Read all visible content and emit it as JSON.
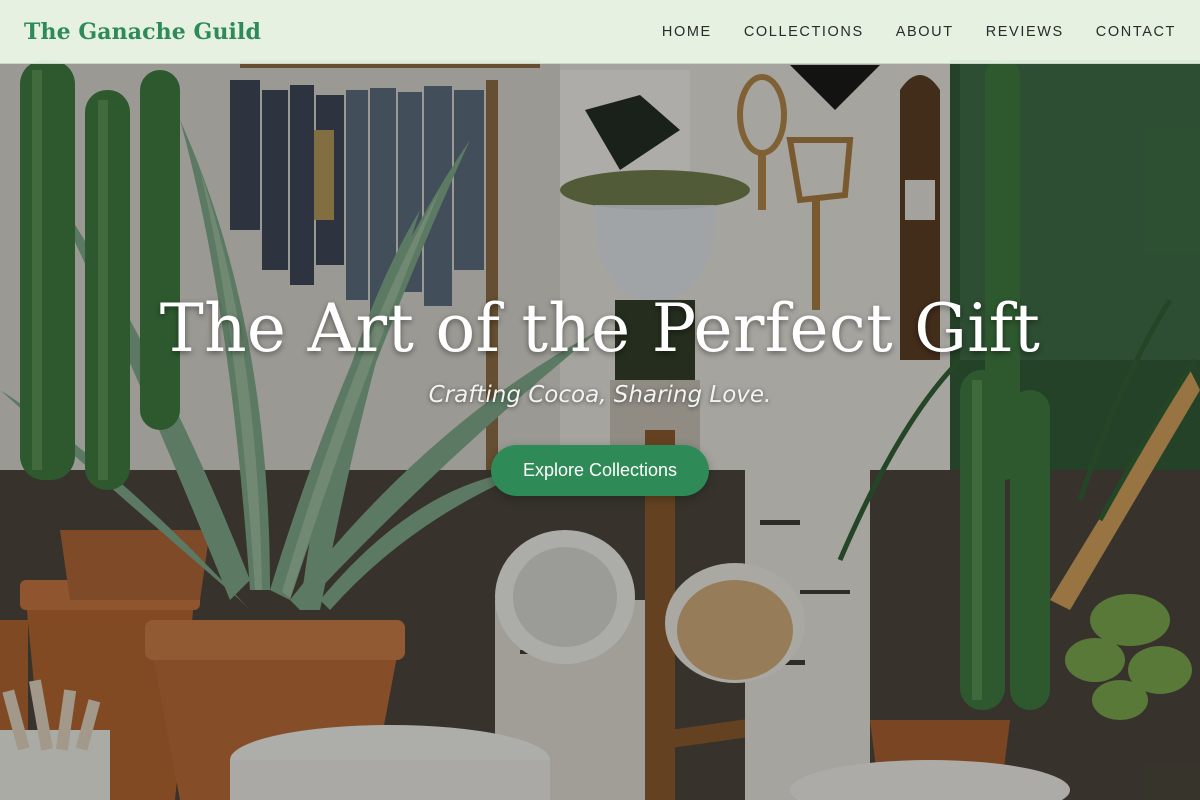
{
  "header": {
    "brand": "The Ganache Guild",
    "nav": [
      {
        "label": "HOME"
      },
      {
        "label": "COLLECTIONS"
      },
      {
        "label": "ABOUT"
      },
      {
        "label": "REVIEWS"
      },
      {
        "label": "CONTACT"
      }
    ]
  },
  "hero": {
    "title": "The Art of the Perfect Gift",
    "subtitle": "Crafting Cocoa, Sharing Love.",
    "cta_label": "Explore Collections"
  },
  "colors": {
    "brand_green": "#2e8b57",
    "header_bg": "#ecf7e8",
    "nav_text": "#2b2b2b"
  }
}
